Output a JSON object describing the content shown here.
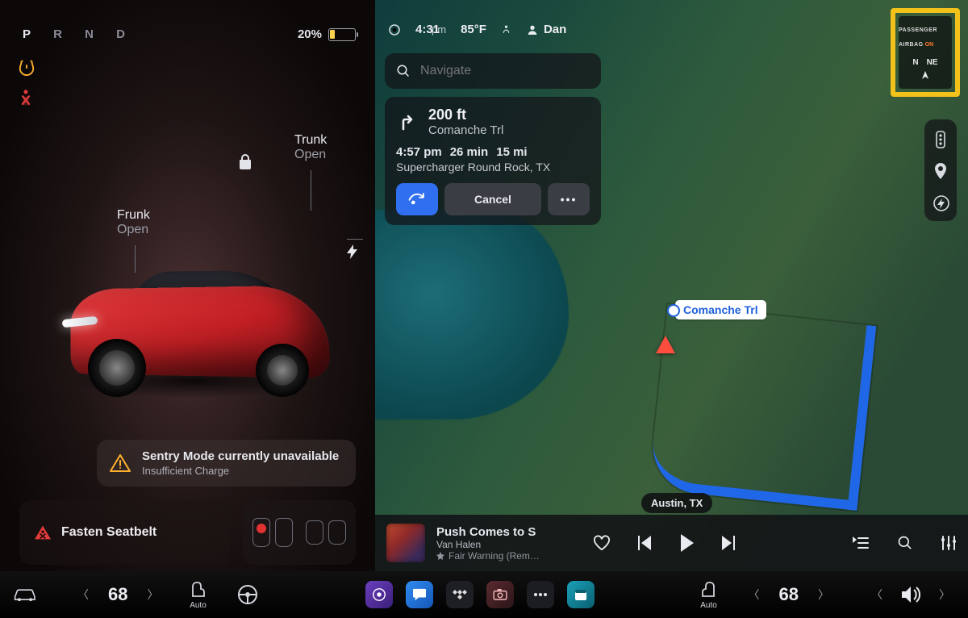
{
  "gear": {
    "letters": [
      "P",
      "R",
      "N",
      "D"
    ],
    "active": "P"
  },
  "battery": {
    "pct_label": "20%",
    "pct_value": 20
  },
  "left": {
    "trunk": {
      "label": "Trunk",
      "action": "Open"
    },
    "frunk": {
      "label": "Frunk",
      "action": "Open"
    },
    "alert": {
      "title": "Sentry Mode currently unavailable",
      "subtitle": "Insufficient Charge"
    },
    "seatbelt_msg": "Fasten Seatbelt"
  },
  "status": {
    "time": "4:31",
    "time_suffix": "pm",
    "temp": "85°F",
    "user": "Dan"
  },
  "nav": {
    "search_placeholder": "Navigate",
    "turn": {
      "distance": "200 ft",
      "street": "Comanche Trl"
    },
    "eta": {
      "arrive": "4:57 pm",
      "duration": "26 min",
      "distance": "15 mi"
    },
    "destination": "Supercharger Round Rock, TX",
    "cancel_label": "Cancel",
    "more_label": "•••",
    "map_street_chip": "Comanche Trl",
    "map_city_chip": "Austin, TX"
  },
  "airbag": {
    "label": "PASSENGER AIRBAG",
    "state": "ON",
    "compass": [
      "N",
      "NE"
    ]
  },
  "media": {
    "title": "Push Comes to S",
    "artist": "Van Halen",
    "album": "Fair Warning (Rem…",
    "favorite": false
  },
  "dock": {
    "left_temp": "68",
    "right_temp": "68",
    "seat_label": "Auto"
  },
  "colors": {
    "accent_blue": "#2f6ff0",
    "route_blue": "#2067e8",
    "warn_amber": "#ffb02e",
    "danger_red": "#e23b3b",
    "battery_low": "#ffd34d",
    "highlight_frame": "#f2c21a",
    "airbag_on": "#ff7a2e"
  }
}
